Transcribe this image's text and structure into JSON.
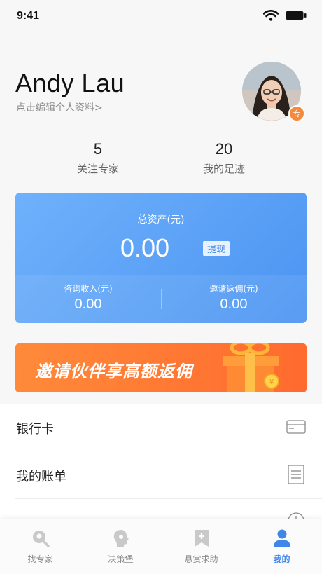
{
  "status_bar": {
    "time": "9:41"
  },
  "profile": {
    "name": "Andy Lau",
    "edit_link": "点击编辑个人资料",
    "badge": "专"
  },
  "stats": [
    {
      "value": "5",
      "label": "关注专家"
    },
    {
      "value": "20",
      "label": "我的足迹"
    }
  ],
  "assets": {
    "title": "总资产(元)",
    "amount": "0.00",
    "withdraw_label": "提现",
    "consult_income": {
      "label": "咨询收入(元)",
      "value": "0.00"
    },
    "invite_rebate": {
      "label": "邀请返佣(元)",
      "value": "0.00"
    }
  },
  "banner": {
    "text": "邀请伙伴享高额返佣"
  },
  "menu": [
    {
      "label": "银行卡",
      "icon": "bank-card-icon"
    },
    {
      "label": "我的账单",
      "icon": "bill-icon"
    },
    {
      "label": "",
      "icon": "clock-icon"
    }
  ],
  "tabbar": [
    {
      "label": "找专家",
      "icon": "search-expert-icon",
      "active": false
    },
    {
      "label": "决策堡",
      "icon": "bulb-icon",
      "active": false
    },
    {
      "label": "悬赏求助",
      "icon": "bounty-icon",
      "active": false
    },
    {
      "label": "我的",
      "icon": "user-icon",
      "active": true
    }
  ],
  "colors": {
    "accent": "#3e86e8",
    "card": "#5aa2f8",
    "banner": "#ff7a34",
    "badge": "#f58a3c"
  }
}
